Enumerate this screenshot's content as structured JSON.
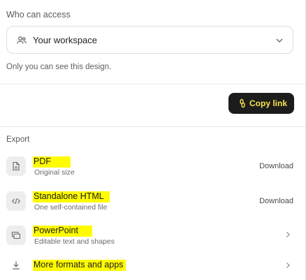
{
  "access": {
    "title": "Who can access",
    "select_value": "Your workspace",
    "note": "Only you can see this design."
  },
  "share": {
    "copy_link_label": "Copy link"
  },
  "export": {
    "title": "Export",
    "items": [
      {
        "title": "PDF",
        "subtitle": "Original size",
        "action": "Download",
        "icon": "document-icon"
      },
      {
        "title": "Standalone HTML",
        "subtitle": "One self-contained file",
        "action": "Download",
        "icon": "code-icon"
      },
      {
        "title": "PowerPoint",
        "subtitle": "Editable text and shapes",
        "action": "",
        "icon": "slides-icon"
      },
      {
        "title": "More formats and apps",
        "subtitle": "",
        "action": "",
        "icon": "download-icon"
      }
    ]
  },
  "colors": {
    "highlight": "#fffb00",
    "button_bg": "#1c1c1c",
    "button_text": "#f7e24a"
  }
}
